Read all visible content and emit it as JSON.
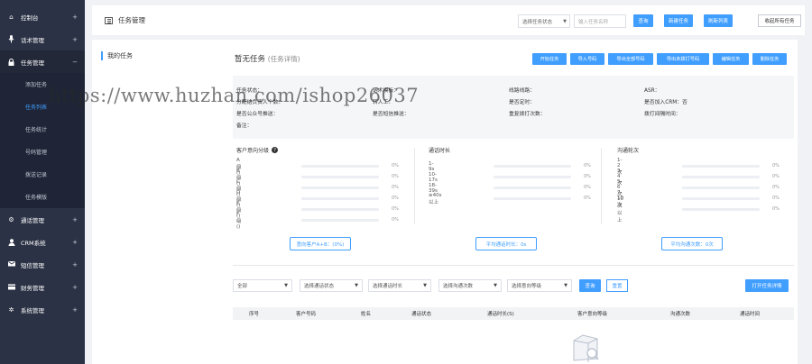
{
  "sidebar": {
    "items": [
      {
        "icon": "home-icon",
        "label": "控制台",
        "arrow": "+"
      },
      {
        "icon": "mic-icon",
        "label": "话术管理",
        "arrow": "+"
      },
      {
        "icon": "lock-icon",
        "label": "任务管理",
        "arrow": "−"
      },
      {
        "icon": "gear-icon",
        "label": "通话管理",
        "arrow": "+"
      },
      {
        "icon": "user-icon",
        "label": "CRM系统",
        "arrow": "+"
      },
      {
        "icon": "sms-icon",
        "label": "短信管理",
        "arrow": "+"
      },
      {
        "icon": "finance-icon",
        "label": "财务管理",
        "arrow": "+"
      },
      {
        "icon": "settings-icon",
        "label": "系统管理",
        "arrow": "+"
      }
    ],
    "submenu": [
      "添加任务",
      "任务列表",
      "任务统计",
      "号码管理",
      "拨送记录",
      "任务模版"
    ],
    "active_sub": 1
  },
  "topbar": {
    "title": "任务管理",
    "status_select": "选择任务状态",
    "search_placeholder": "输入任务名称",
    "query_btn": "查询",
    "create_btn": "新建任务",
    "refresh_btn": "刷新列表",
    "collapse_btn": "收起所有任务"
  },
  "left": {
    "title": "我的任务"
  },
  "content": {
    "title": "暂无任务",
    "subtitle": "(任务详情)",
    "actions": [
      "开始任务",
      "导入号码",
      "导出全部号码",
      "导出未拨打号码",
      "编辑任务",
      "删除任务"
    ]
  },
  "info": {
    "task_status": "任务状态：",
    "script_template": "话术模板：",
    "line": "线路线路：",
    "asr": "ASR：",
    "assignee": "分配给负责人个数：",
    "transfer": "转人工：",
    "timed": "是否定时：",
    "add_crm": "是否加入CRM：否",
    "wechat_push": "是否公众号推送：",
    "sms_push": "是否短信推送：",
    "retry": "重复拨打次数：",
    "retry_interval": "拨打间隔时间：",
    "remark": "备注："
  },
  "dist": {
    "intent": {
      "title": "客户意向分级",
      "rows": [
        {
          "label": "A级()",
          "pct": "0%"
        },
        {
          "label": "B级()",
          "pct": "0%"
        },
        {
          "label": "C级()",
          "pct": "0%"
        },
        {
          "label": "D级()",
          "pct": "0%"
        },
        {
          "label": "E级()",
          "pct": "0%"
        },
        {
          "label": "F级()",
          "pct": "0%"
        }
      ],
      "button": "意向客户A+B：(0%)"
    },
    "duration": {
      "title": "通话时长",
      "rows": [
        {
          "label": "1-9s",
          "pct": "0%"
        },
        {
          "label": "10-17s",
          "pct": "0%"
        },
        {
          "label": "18-39s",
          "pct": "0%"
        },
        {
          "label": "≥40s以上",
          "pct": "0%"
        }
      ],
      "button": "平均通话时长：0s"
    },
    "rounds": {
      "title": "沟通轮次",
      "rows": [
        {
          "label": "1-2次",
          "pct": "0%"
        },
        {
          "label": "3-4次",
          "pct": "0%"
        },
        {
          "label": "5-6次",
          "pct": "0%"
        },
        {
          "label": "7-10次",
          "pct": "0%"
        },
        {
          "label": "10次以上",
          "pct": "0%"
        }
      ],
      "button": "平均沟通次数：0次"
    }
  },
  "filters": {
    "all": "全部",
    "call_status": "选择通话状态",
    "duration": "选择通话时长",
    "rounds": "选择沟通次数",
    "intent": "选择意向等级",
    "query_btn": "查询",
    "reset_btn": "重置",
    "open_detail_btn": "打开任务详情"
  },
  "table": {
    "headers": [
      "序号",
      "客户号码",
      "姓名",
      "通话状态",
      "通话时长(S)",
      "客户意向等级",
      "沟通次数",
      "通话时间"
    ]
  },
  "watermark": "https://www.huzhan.com/ishop26037"
}
